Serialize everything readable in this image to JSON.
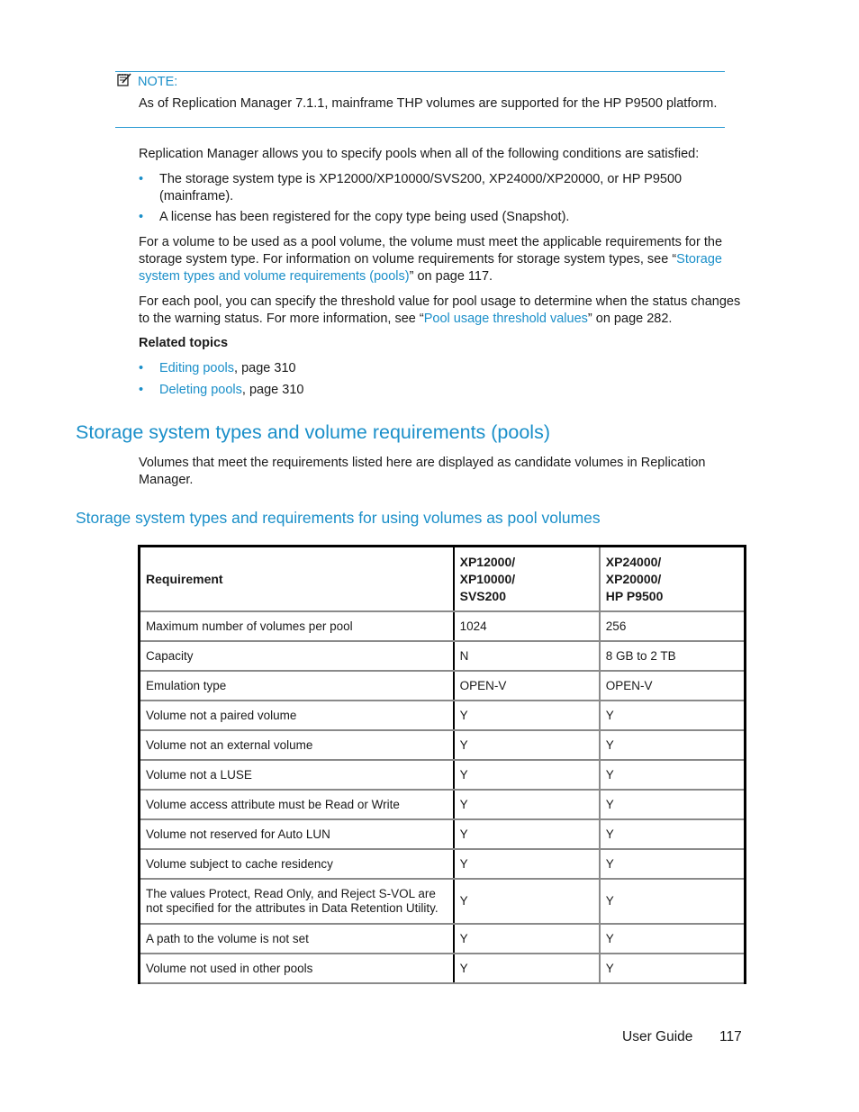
{
  "note": {
    "icon": "note-pencil-icon",
    "label": "NOTE:",
    "text": "As of Replication Manager 7.1.1, mainframe THP volumes are supported for the HP P9500 platform."
  },
  "intro": "Replication Manager allows you to specify pools when all of the following conditions are satisfied:",
  "conditions": [
    {
      "line1": "The storage system type is XP12000/XP10000/SVS200, XP24000/XP20000, or HP P9500",
      "line2": "(mainframe)."
    },
    {
      "line1": "A license has been registered for the copy type being used (Snapshot)."
    }
  ],
  "para_pool_volume": {
    "line1": "For a volume to be used as a pool volume, the volume must meet the applicable requirements for the",
    "line2_prefix": "storage system type. For information on volume requirements for storage system types, see “",
    "link_part1": "Storage",
    "link_part2": "system types and volume requirements (pools)",
    "suffix": "” on page 117."
  },
  "para_threshold": {
    "line1": "For each pool, you can specify the threshold value for pool usage to determine when the status changes",
    "line2_prefix": "to the warning status. For more information, see “",
    "link": "Pool usage threshold values",
    "suffix": "” on page 282."
  },
  "related_topics": {
    "heading": "Related topics",
    "items": [
      {
        "link": "Editing pools",
        "suffix": ", page 310"
      },
      {
        "link": "Deleting pools",
        "suffix": ", page 310"
      }
    ]
  },
  "section": {
    "title": "Storage system types and volume requirements (pools)",
    "description_line1": "Volumes that meet the requirements listed here are displayed as candidate volumes in Replication",
    "description_line2": "Manager."
  },
  "table": {
    "title": "Storage system types and requirements for using volumes as pool volumes",
    "headers": [
      {
        "lines": [
          "Requirement"
        ]
      },
      {
        "lines": [
          "XP12000/",
          "XP10000/",
          "SVS200"
        ]
      },
      {
        "lines": [
          "XP24000/",
          "XP20000/",
          "HP P9500"
        ]
      }
    ],
    "rows": [
      [
        "Maximum number of volumes per pool",
        "1024",
        "256"
      ],
      [
        "Capacity",
        "N",
        "8 GB to 2 TB"
      ],
      [
        "Emulation type",
        "OPEN-V",
        "OPEN-V"
      ],
      [
        "Volume not a paired volume",
        "Y",
        "Y"
      ],
      [
        "Volume not an external volume",
        "Y",
        "Y"
      ],
      [
        "Volume not a LUSE",
        "Y",
        "Y"
      ],
      [
        "Volume access attribute must be Read or Write",
        "Y",
        "Y"
      ],
      [
        "Volume not reserved for Auto LUN",
        "Y",
        "Y"
      ],
      [
        "Volume subject to cache residency",
        "Y",
        "Y"
      ],
      [
        "The values Protect, Read Only, and Reject S-VOL are not specified for the attributes in Data Retention Utility.",
        "Y",
        "Y"
      ],
      [
        "A path to the volume is not set",
        "Y",
        "Y"
      ],
      [
        "Volume not used in other pools",
        "Y",
        "Y"
      ]
    ]
  },
  "footer": {
    "doc_name": "User Guide",
    "page_number": "117"
  }
}
